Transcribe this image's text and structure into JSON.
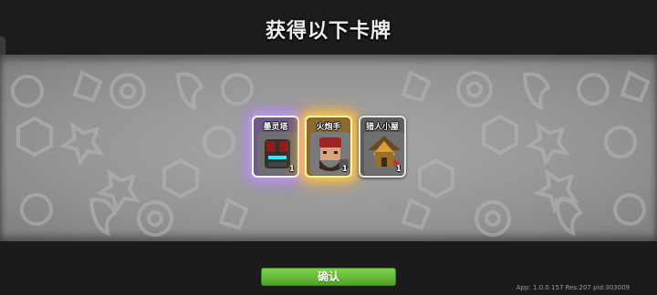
{
  "header": {
    "title": "获得以下卡牌"
  },
  "cards": [
    {
      "name": "墨灵塔",
      "count": "1",
      "rarity_color": "#c89cff"
    },
    {
      "name": "火炮手",
      "count": "1",
      "rarity_color": "#ffc845"
    },
    {
      "name": "猎人小屋",
      "count": "1",
      "rarity_color": "#e6e6e6"
    }
  ],
  "footer": {
    "confirm_label": "确认",
    "version": "App: 1.0.0.157 Res:207 pid:303009"
  },
  "icons": [
    "rune-pattern-icon",
    "tower-icon",
    "gunner-icon",
    "hut-icon"
  ]
}
